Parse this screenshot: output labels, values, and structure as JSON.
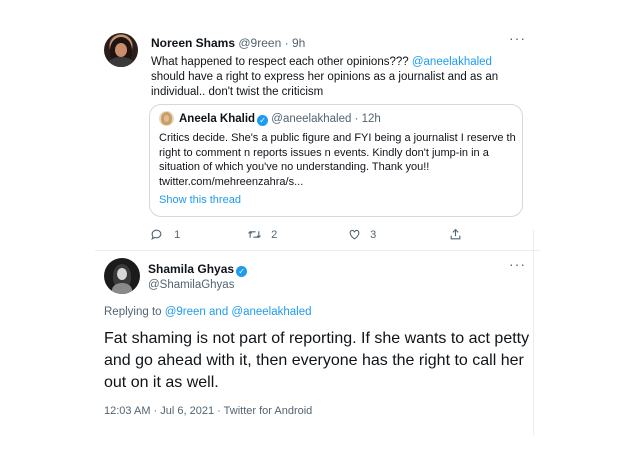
{
  "tweet1": {
    "author_name": "Noreen Shams",
    "author_handle": "@9reen",
    "time": "9h",
    "text_part1": "What happened to respect each other opinions??? ",
    "mention": "@aneelakhaled",
    "text_part2": " should have a right to express her opinions as a journalist and as an individual.. don't twist the criticism",
    "more_label": "···",
    "quote": {
      "author_name": "Aneela Khalid",
      "author_handle": "@aneelakhaled",
      "time": "12h",
      "text": "Critics decide. She's a public figure and FYI being a journalist I reserve th right to comment n reports issues n events. Kindly don't jump-in in a situation of which you've no understanding. Thank you!! twitter.com/mehreenzahra/s...",
      "show_thread": "Show this thread"
    },
    "actions": {
      "reply_count": "1",
      "retweet_count": "2",
      "like_count": "3"
    }
  },
  "tweet2": {
    "author_name": "Shamila Ghyas",
    "author_handle": "@ShamilaGhyas",
    "more_label": "···",
    "replying_prefix": "Replying to ",
    "replying_user1": "@9reen",
    "replying_and": " and ",
    "replying_user2": "@aneelakhaled",
    "text": "Fat shaming is not part of reporting. If she wants to act petty and go ahead with it, then everyone has the right to call her out on it as well.",
    "meta": "12:03 AM · Jul 6, 2021 · Twitter for Android"
  },
  "colors": {
    "accent": "#1d9bf0",
    "muted": "#536471",
    "text": "#0f1419",
    "border": "#cfd9de"
  }
}
